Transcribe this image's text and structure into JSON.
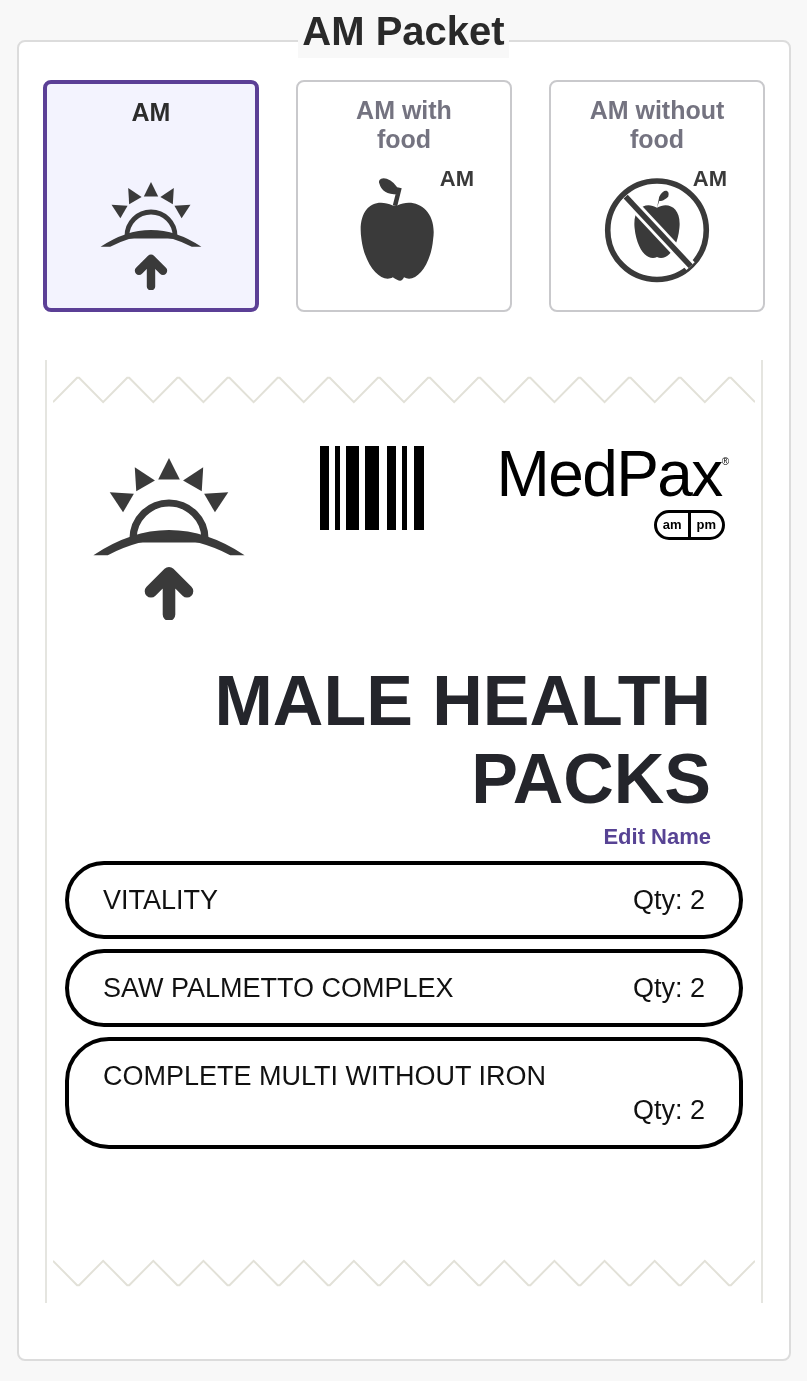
{
  "title": "AM Packet",
  "tabs": [
    {
      "label": "AM",
      "kind": "sunrise",
      "selected": true
    },
    {
      "label": "AM with food",
      "kind": "apple",
      "badge": "AM",
      "selected": false
    },
    {
      "label": "AM without food",
      "kind": "no-apple",
      "badge": "AM",
      "selected": false
    }
  ],
  "packet": {
    "logo": {
      "name": "MedPax",
      "mark": "®",
      "pill": [
        "am",
        "pm"
      ]
    },
    "name": "MALE HEALTH PACKS",
    "edit_link": "Edit Name",
    "items": [
      {
        "name": "VITALITY",
        "qty": "Qty: 2"
      },
      {
        "name": "SAW PALMETTO COMPLEX",
        "qty": "Qty: 2"
      },
      {
        "name": "COMPLETE MULTI WITHOUT IRON",
        "qty": "Qty: 2"
      }
    ]
  }
}
